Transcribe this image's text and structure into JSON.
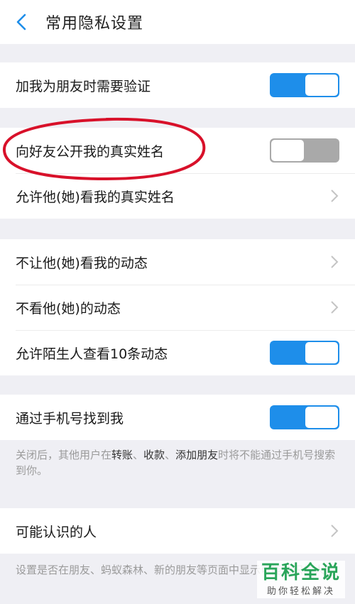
{
  "header": {
    "back_icon": "chevron-left-icon",
    "title": "常用隐私设置"
  },
  "friend_verify": {
    "label": "加我为朋友时需要验证",
    "enabled": true
  },
  "real_name": {
    "show_label": "向好友公开我的真实姓名",
    "show_enabled": false,
    "allow_label": "允许他(她)看我的真实姓名"
  },
  "moments": {
    "hide_mine": "不让他(她)看我的动态",
    "hide_theirs": "不看他(她)的动态",
    "stranger_label": "允许陌生人查看10条动态",
    "stranger_enabled": true
  },
  "phone": {
    "label": "通过手机号找到我",
    "enabled": true,
    "hint_pre": "关闭后，其他用户在",
    "hint_b1": "转账",
    "hint_sep1": "、",
    "hint_b2": "收款",
    "hint_sep2": "、",
    "hint_b3": "添加朋友",
    "hint_post": "时将不能通过手机号搜索到你。"
  },
  "people": {
    "label": "可能认识的人",
    "hint": "设置是否在朋友、蚂蚁森林、新的朋友等页面中显示可能认识的人"
  },
  "watermark": {
    "main": "百科全说",
    "sub": "助你轻松解决"
  },
  "colors": {
    "accent": "#1e8eea",
    "toggle_off": "#a9a9a9",
    "annotation": "#d8112a",
    "watermark": "#2aa55a"
  }
}
